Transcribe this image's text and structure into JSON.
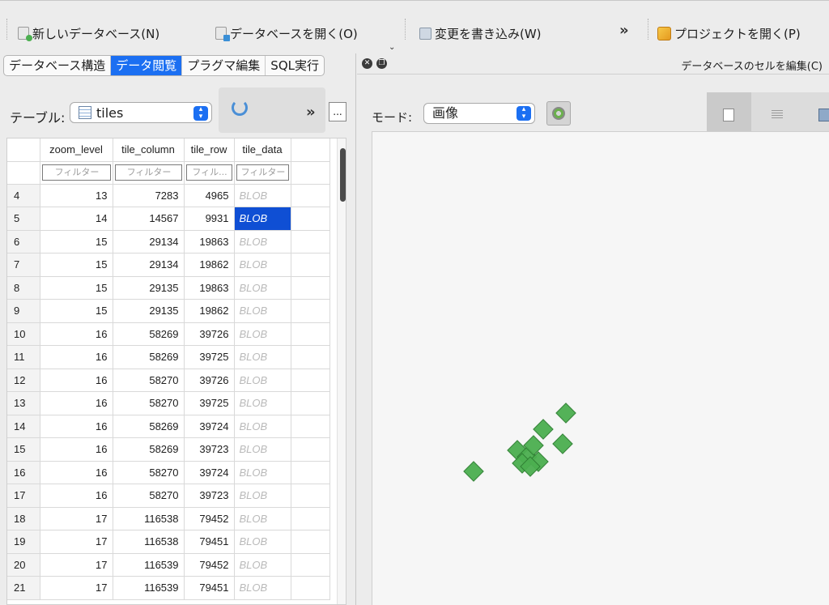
{
  "toolbar": {
    "new_db": "新しいデータベース(N)",
    "open_db": "データベースを開く(O)",
    "write_changes": "変更を書き込み(W)",
    "more": "»",
    "open_project": "プロジェクトを開く(P)",
    "chevron": "⌄"
  },
  "left": {
    "tabs": [
      "データベース構造",
      "データ閲覧",
      "プラグマ編集",
      "SQL実行"
    ],
    "table_label": "テーブル:",
    "table_value": "tiles",
    "more": "»",
    "dots": "...",
    "columns": [
      "zoom_level",
      "tile_column",
      "tile_row",
      "tile_data"
    ],
    "filters": [
      "フィルター",
      "フィルター",
      "フィル...",
      "フィルター"
    ],
    "rows": [
      {
        "n": "4",
        "z": "13",
        "c": "7283",
        "r": "4965",
        "d": "BLOB"
      },
      {
        "n": "5",
        "z": "14",
        "c": "14567",
        "r": "9931",
        "d": "BLOB"
      },
      {
        "n": "6",
        "z": "15",
        "c": "29134",
        "r": "19863",
        "d": "BLOB"
      },
      {
        "n": "7",
        "z": "15",
        "c": "29134",
        "r": "19862",
        "d": "BLOB"
      },
      {
        "n": "8",
        "z": "15",
        "c": "29135",
        "r": "19863",
        "d": "BLOB"
      },
      {
        "n": "9",
        "z": "15",
        "c": "29135",
        "r": "19862",
        "d": "BLOB"
      },
      {
        "n": "10",
        "z": "16",
        "c": "58269",
        "r": "39726",
        "d": "BLOB"
      },
      {
        "n": "11",
        "z": "16",
        "c": "58269",
        "r": "39725",
        "d": "BLOB"
      },
      {
        "n": "12",
        "z": "16",
        "c": "58270",
        "r": "39726",
        "d": "BLOB"
      },
      {
        "n": "13",
        "z": "16",
        "c": "58270",
        "r": "39725",
        "d": "BLOB"
      },
      {
        "n": "14",
        "z": "16",
        "c": "58269",
        "r": "39724",
        "d": "BLOB"
      },
      {
        "n": "15",
        "z": "16",
        "c": "58269",
        "r": "39723",
        "d": "BLOB"
      },
      {
        "n": "16",
        "z": "16",
        "c": "58270",
        "r": "39724",
        "d": "BLOB"
      },
      {
        "n": "17",
        "z": "16",
        "c": "58270",
        "r": "39723",
        "d": "BLOB"
      },
      {
        "n": "18",
        "z": "17",
        "c": "116538",
        "r": "79452",
        "d": "BLOB"
      },
      {
        "n": "19",
        "z": "17",
        "c": "116538",
        "r": "79451",
        "d": "BLOB"
      },
      {
        "n": "20",
        "z": "17",
        "c": "116539",
        "r": "79452",
        "d": "BLOB"
      },
      {
        "n": "21",
        "z": "17",
        "c": "116539",
        "r": "79451",
        "d": "BLOB"
      }
    ],
    "selected_row": "5"
  },
  "right": {
    "title": "データベースのセルを編集(C)",
    "mode_label": "モード:",
    "mode_value": "画像"
  },
  "colors": {
    "accent": "#1b6ff2",
    "selection": "#0f4fd4",
    "marker": "#4caf50"
  }
}
